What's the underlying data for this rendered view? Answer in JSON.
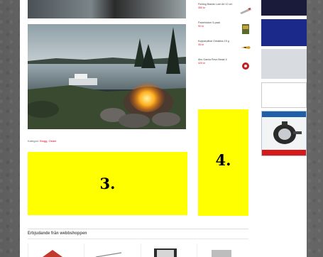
{
  "article": {
    "category_label": "Kategori:",
    "category_link": "Blogg, Okänt"
  },
  "ads": {
    "slot3": "3.",
    "slot4": "4."
  },
  "shop_products": [
    {
      "title": "Fishing Brands Lure Art 12 cm",
      "price": "350 kr"
    },
    {
      "title": "Fiskeböcker 5-pack",
      "price": "90 kr"
    },
    {
      "title": "Kopparpilkar Gösskiss 15 g",
      "price": "35 kr"
    },
    {
      "title": "Abu Garcia Revo Beast X",
      "price": "425 kr"
    }
  ],
  "sidebar": {
    "banner1": "",
    "banner2_big": "",
    "banner2_text": "",
    "banner3": "",
    "banner4": ""
  },
  "section": {
    "heading": "Erbjudande från webbshoppen"
  },
  "colors": {
    "ad_yellow": "#ffff00",
    "link_red": "#d0102a"
  }
}
